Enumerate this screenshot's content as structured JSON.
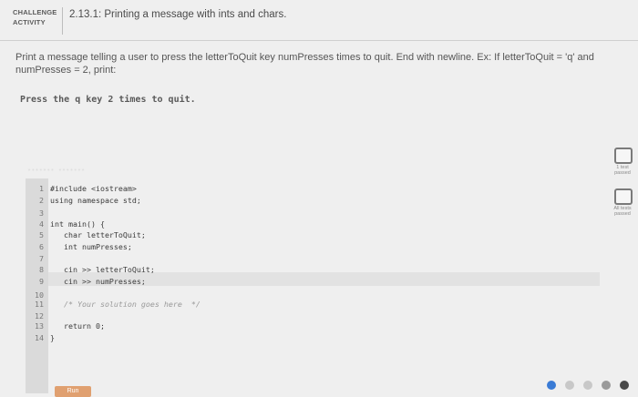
{
  "header": {
    "badge_line1": "CHALLENGE",
    "badge_line2": "ACTIVITY",
    "title": "2.13.1: Printing a message with ints and chars."
  },
  "prompt": {
    "line1": "Print a message telling a user to press the letterToQuit key numPresses times to quit. End with newline. Ex: If letterToQuit = 'q' and",
    "line2": "numPresses = 2, print:",
    "example_output": "Press the q key 2 times to quit."
  },
  "editor": {
    "lines": [
      {
        "n": "1",
        "code": "#include <iostream>"
      },
      {
        "n": "2",
        "code": "using namespace std;"
      },
      {
        "n": "3",
        "code": ""
      },
      {
        "n": "4",
        "code": "int main() {"
      },
      {
        "n": "5",
        "code": "   char letterToQuit;"
      },
      {
        "n": "6",
        "code": "   int numPresses;"
      },
      {
        "n": "7",
        "code": ""
      },
      {
        "n": "8",
        "code": "   cin >> letterToQuit;"
      },
      {
        "n": "9",
        "code": "   cin >> numPresses;"
      },
      {
        "n": "10",
        "code": ""
      },
      {
        "n": "11",
        "code": "   /* Your solution goes here  */"
      },
      {
        "n": "12",
        "code": ""
      },
      {
        "n": "13",
        "code": "   return 0;"
      },
      {
        "n": "14",
        "code": "}"
      }
    ]
  },
  "side": {
    "test1_label": "1 test passed",
    "test2_label": "All tests passed"
  },
  "run_label": "Run"
}
